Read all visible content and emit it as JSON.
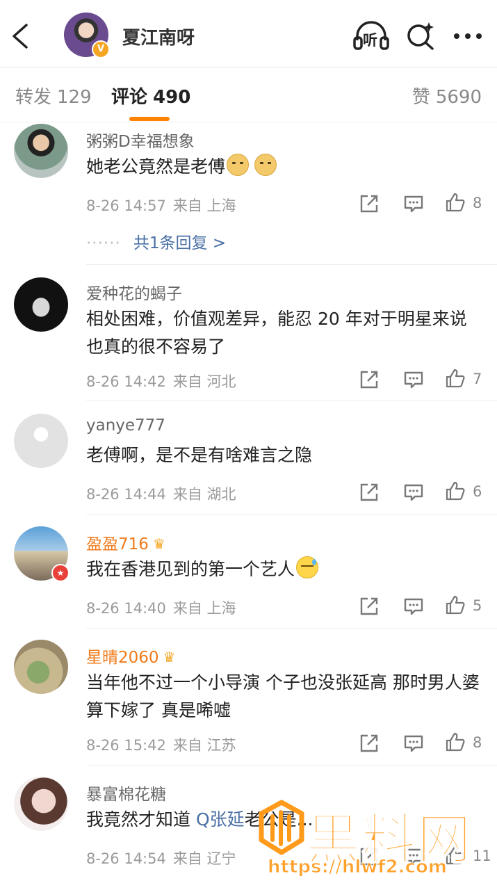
{
  "header": {
    "back_icon": "chevron-left-icon",
    "user_name": "夏江南呀",
    "listen_label": "听",
    "badge_label": "V"
  },
  "tabs": {
    "repost": {
      "label": "转发",
      "count": "129"
    },
    "comment": {
      "label": "评论",
      "count": "490"
    },
    "like": {
      "label": "赞",
      "count": "5690"
    },
    "accent": "#ff8200"
  },
  "comments": [
    {
      "name": "粥粥D幸福想象",
      "text": "她老公竟然是老傅",
      "emojis": [
        "doge",
        "doge"
      ],
      "date": "8-26 14:57",
      "source": "来自 上海",
      "likes": "8",
      "more_replies": "共1条回复 >",
      "more_dots": "······"
    },
    {
      "name": "爱种花的蝎子",
      "text": "相处困难，价值观差异，能忍 20 年对于明星来说也真的很不容易了",
      "date": "8-26 14:42",
      "source": "来自 河北",
      "likes": "7"
    },
    {
      "name": "yanye777",
      "text": "老傅啊，是不是有啥难言之隐",
      "date": "8-26 14:44",
      "source": "来自 湖北",
      "likes": "6"
    },
    {
      "name": "盈盈716",
      "vip": true,
      "text": "我在香港见到的第一个艺人",
      "emojis": [
        "sweat"
      ],
      "date": "8-26 14:40",
      "source": "来自 上海",
      "likes": "5"
    },
    {
      "name": "星晴2060",
      "vip": true,
      "text": "当年他不过一个小导演 个子也没张延高 那时男人婆算下嫁了 真是唏嘘",
      "date": "8-26 15:42",
      "source": "来自 江苏",
      "likes": "8"
    },
    {
      "name": "暴富棉花糖",
      "text_prefix": "我竟然才知道 ",
      "hashtag": "Q张延",
      "text_suffix": "老公是...",
      "date": "8-26 14:54",
      "source": "来自 辽宁",
      "likes": "11"
    }
  ],
  "watermark": {
    "title": "黑料网",
    "url": "https://hlwf2.com",
    "color": "#ff9a1a"
  },
  "icons": {
    "share": "share-icon",
    "reply": "reply-icon",
    "like": "thumbs-up-icon",
    "vip_crown": "crown-icon"
  }
}
